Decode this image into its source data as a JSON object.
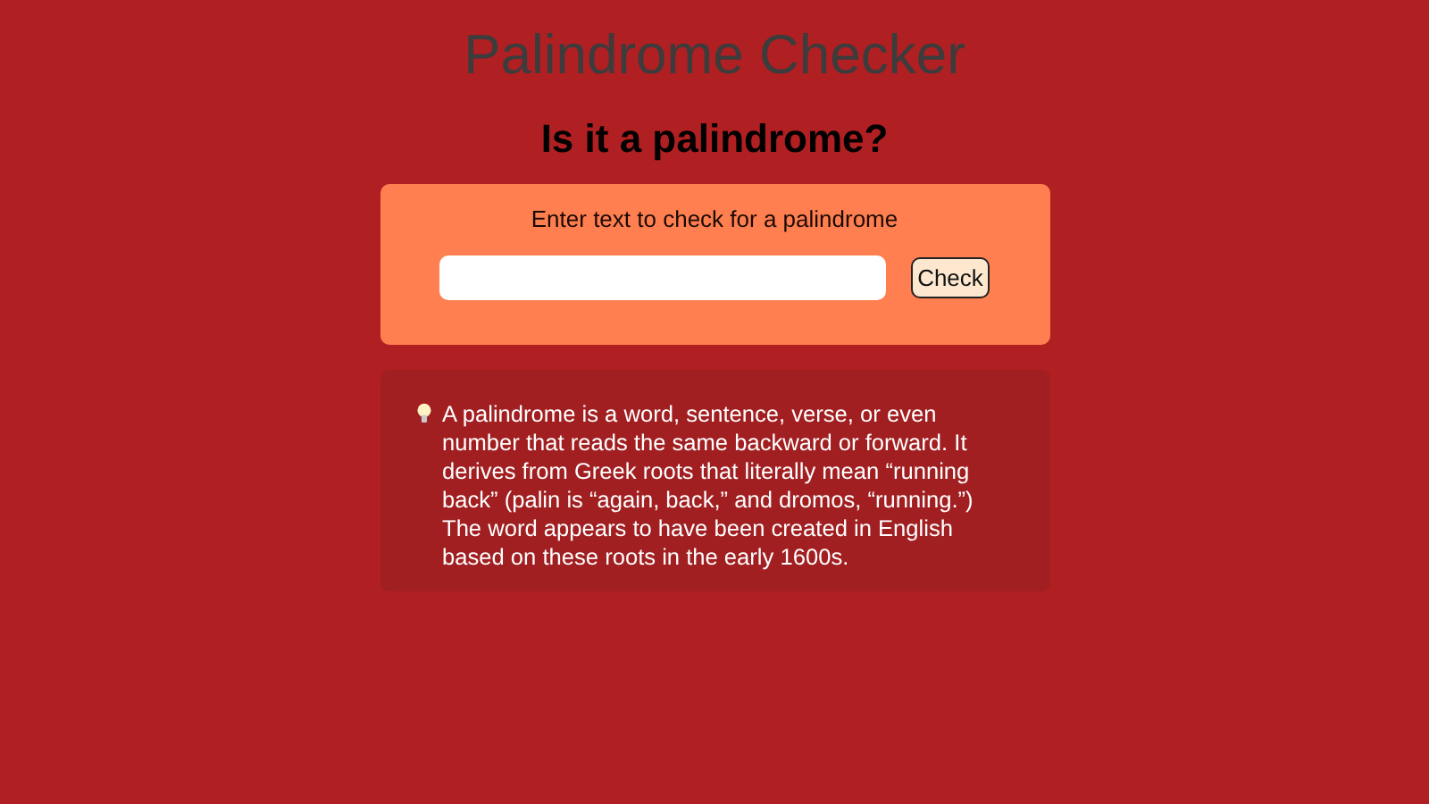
{
  "title": "Palindrome Checker",
  "heading": "Is it a palindrome?",
  "form": {
    "label": "Enter text to check for a palindrome",
    "button": "Check"
  },
  "info": {
    "text": "A palindrome is a word, sentence, verse, or even number that reads the same backward or forward. It derives from Greek roots that literally mean “running back” (palin is “again, back,” and dromos, “running.”) The word appears to have been created in English based on these roots in the early 1600s."
  }
}
